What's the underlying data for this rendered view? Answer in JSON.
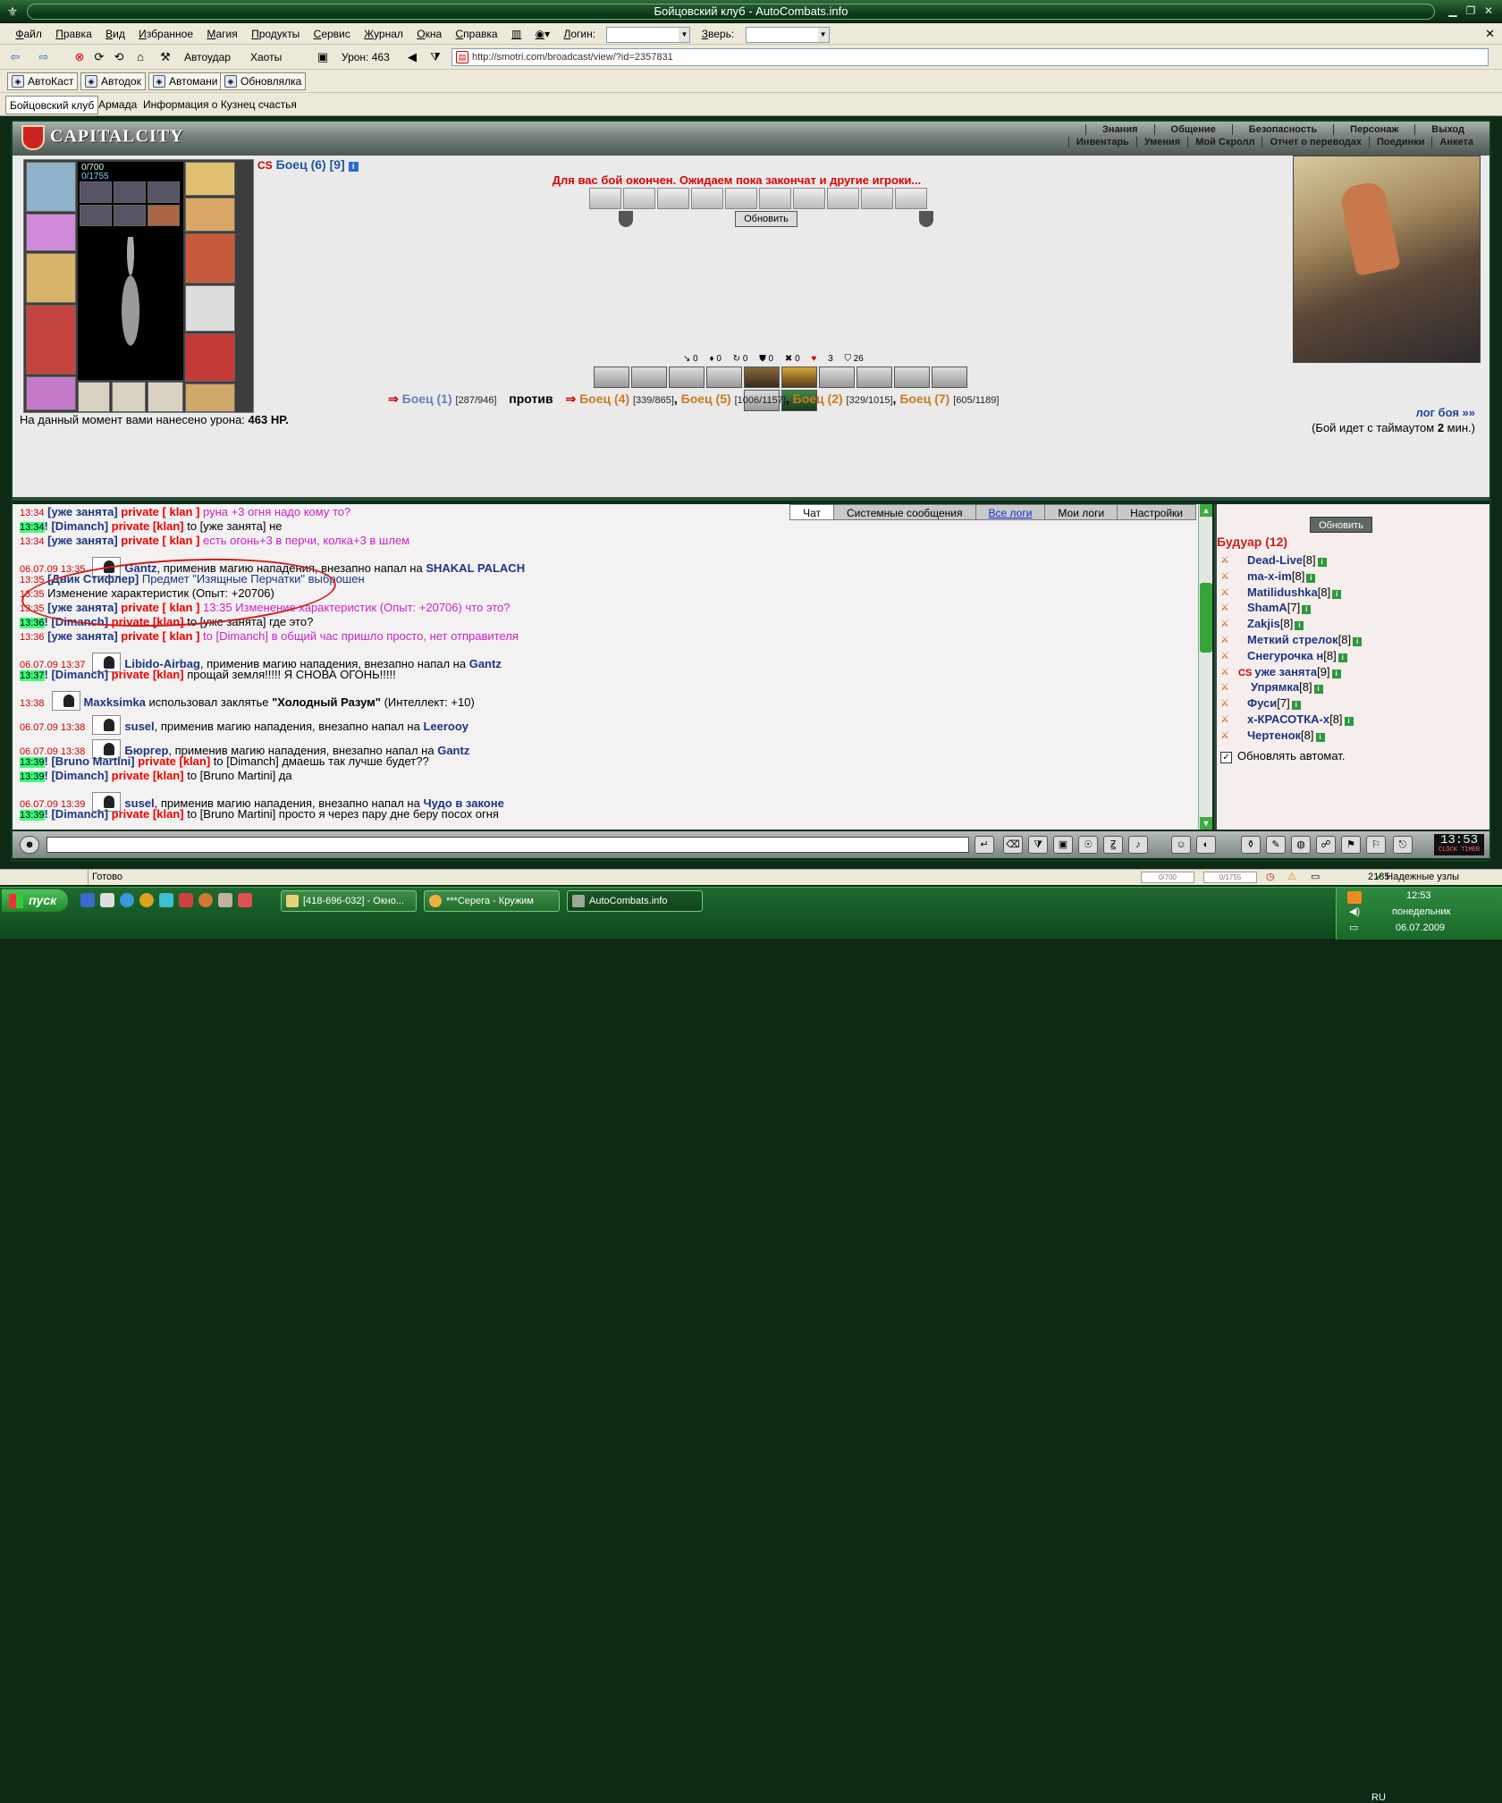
{
  "window": {
    "title": "Бойцовский клуб - AutoCombats.info"
  },
  "menu": {
    "items": [
      "Файл",
      "Правка",
      "Вид",
      "Избранное",
      "Магия",
      "Продукты",
      "Сервис",
      "Журнал",
      "Окна",
      "Справка"
    ],
    "login_label": "Логин:",
    "beast_label": "Зверь:"
  },
  "toolbar": {
    "autostrike": "Автоудар",
    "chaos": "Хаоты",
    "damage": "Урон: 463",
    "url": "http://smotri.com/broadcast/view/?id=2357831"
  },
  "plugins": [
    "АвтоКаст",
    "Автодок",
    "Автомани",
    "Обновлялка"
  ],
  "page_tabs": [
    "Бойцовский клуб",
    "Армада",
    "Информация о Кузнец счастья"
  ],
  "game": {
    "logo": "CAPITALCITY",
    "nav_row1": [
      "Знания",
      "Общение",
      "Безопасность",
      "Персонаж",
      "Выход"
    ],
    "nav_row2": [
      "Инвентарь",
      "Умения",
      "Мой Скролл",
      "Отчет о переводах",
      "Поединки",
      "Анкета"
    ],
    "hp": "0/700",
    "mana": "0/1755",
    "clan_tag": "CS",
    "fighter": "Боец (6) [9]",
    "battle_msg": "Для вас бой окончен. Ожидаем пока закончат и другие игроки...",
    "refresh": "Обновить",
    "stats": [
      "0",
      "0",
      "0",
      "0",
      "0",
      "3",
      "26"
    ],
    "team1": {
      "name": "Боец (1)",
      "hp": "[287/946]"
    },
    "vs": "против",
    "team2": [
      {
        "name": "Боец (4)",
        "hp": "[339/865]"
      },
      {
        "name": "Боец (5)",
        "hp": "[1006/1157]"
      },
      {
        "name": "Боец (2)",
        "hp": "[329/1015]"
      },
      {
        "name": "Боец (7)",
        "hp": "[605/1189]"
      }
    ],
    "damage_text": "На данный момент вами нанесено урона:",
    "damage_value": "463 HP.",
    "log_link": "лог боя »»",
    "timeout_pre": "(Бой идет с таймаутом",
    "timeout_val": "2",
    "timeout_post": "мин.)"
  },
  "chat": {
    "tabs": [
      "Чат",
      "Системные сообщения",
      "Все логи",
      "Мои логи",
      "Настройки"
    ],
    "lines": [
      {
        "time": "13:34",
        "nick": "[уже занята]",
        "priv": "private [ klan ]",
        "text": "руна +3 огня надо кому то?"
      },
      {
        "time": "13:34",
        "nick": "! [Dimanch]",
        "priv": "private [klan]",
        "text": "to [уже занята] не"
      },
      {
        "time": "13:34",
        "nick": "[уже занята]",
        "priv": "private [ klan ]",
        "text": "есть огонь+3 в перчи, колка+3 в шлем"
      },
      {
        "time": "06.07.09 13:35",
        "actor": "Gantz",
        "text": ", применив магию нападения, внезапно напал на",
        "target": "SHAKAL PALACH"
      },
      {
        "time": "13:35",
        "nick": "[Двик Стифлер]",
        "text": "Предмет \"Изящные Перчатки\" выброшен"
      },
      {
        "time": "13:35",
        "text": "Изменение характеристик (Опыт: +20706)"
      },
      {
        "time": "13:35",
        "nick": "[уже занята]",
        "priv": "private [ klan ]",
        "text": "13:35 Изменение характеристик (Опыт: +20706) что это?"
      },
      {
        "time": "13:36",
        "nick": "! [Dimanch]",
        "priv": "private [klan]",
        "text": "to [уже занята] где это?"
      },
      {
        "time": "13:36",
        "nick": "[уже занята]",
        "priv": "private [ klan ]",
        "text": "to [Dimanch] в общий час пришло просто, нет отправителя"
      },
      {
        "time": "06.07.09 13:37",
        "actor": "Libido-Airbag",
        "text": ", применив магию нападения, внезапно напал на",
        "target": "Gantz"
      },
      {
        "time": "13:37",
        "nick": "! [Dimanch]",
        "priv": "private [klan]",
        "text": "прощай земля!!!!! Я СНОВА ОГОНЬ!!!!!"
      },
      {
        "time": "13:38",
        "actor": "Maxksimka",
        "text": "использовал заклятье",
        "spell": "\"Холодный Разум\"",
        "tail": "(Интеллект: +10)"
      },
      {
        "time": "06.07.09 13:38",
        "actor": "susel",
        "text": ", применив магию нападения, внезапно напал на",
        "target": "Leerooy"
      },
      {
        "time": "06.07.09 13:38",
        "actor": "Бюргер",
        "text": ", применив магию нападения, внезапно напал на",
        "target": "Gantz"
      },
      {
        "time": "13:39",
        "nick": "! [Bruno Martini]",
        "priv": "private [klan]",
        "text": "to [Dimanch] дмаешь так лучше будет??"
      },
      {
        "time": "13:39",
        "nick": "! [Dimanch]",
        "priv": "private [klan]",
        "text": "to [Bruno Martini] да"
      },
      {
        "time": "06.07.09 13:39",
        "actor": "susel",
        "text": ", применив магию нападения, внезапно напал на",
        "target": "Чудо в законе"
      },
      {
        "time": "13:39",
        "nick": "! [Dimanch]",
        "priv": "private [klan]",
        "text": "to [Bruno Martini] просто я через пару дне беру посох огня"
      }
    ]
  },
  "users": {
    "refresh": "Обновить",
    "room": "Будуар (12)",
    "list": [
      {
        "name": "Dead-Live",
        "level": "[8]"
      },
      {
        "name": "ma-x-im",
        "level": "[8]"
      },
      {
        "name": "Matilidushka",
        "level": "[8]"
      },
      {
        "name": "ShamA",
        "level": "[7]"
      },
      {
        "name": "Zakjis",
        "level": "[8]"
      },
      {
        "name": "Меткий стрелок",
        "level": "[8]"
      },
      {
        "name": "Снегурочка н",
        "level": "[8]"
      },
      {
        "name": "уже занята",
        "level": "[9]",
        "clan": "CS"
      },
      {
        "name": "Упрямка",
        "level": "[8]"
      },
      {
        "name": "Фуси",
        "level": "[7]"
      },
      {
        "name": "x-КРАСОТКА-x",
        "level": "[8]"
      },
      {
        "name": "Чертенок",
        "level": "[8]"
      }
    ],
    "auto": "Обновлять автомат."
  },
  "chatbar": {
    "clock": "13:53",
    "clock_label": "CLOCK TIMER"
  },
  "statusbar": {
    "ready": "Готово",
    "hp": "0/700",
    "mana": "0/1755",
    "num": "2185",
    "trust": "Надежные узлы"
  },
  "taskbar": {
    "start": "пуск",
    "tasks": [
      "[418-696-032] - Окно...",
      "***Серега - Кружим",
      "AutoCombats.info"
    ],
    "lang": "RU",
    "time": "12:53",
    "day": "понедельник",
    "date": "06.07.2009"
  }
}
